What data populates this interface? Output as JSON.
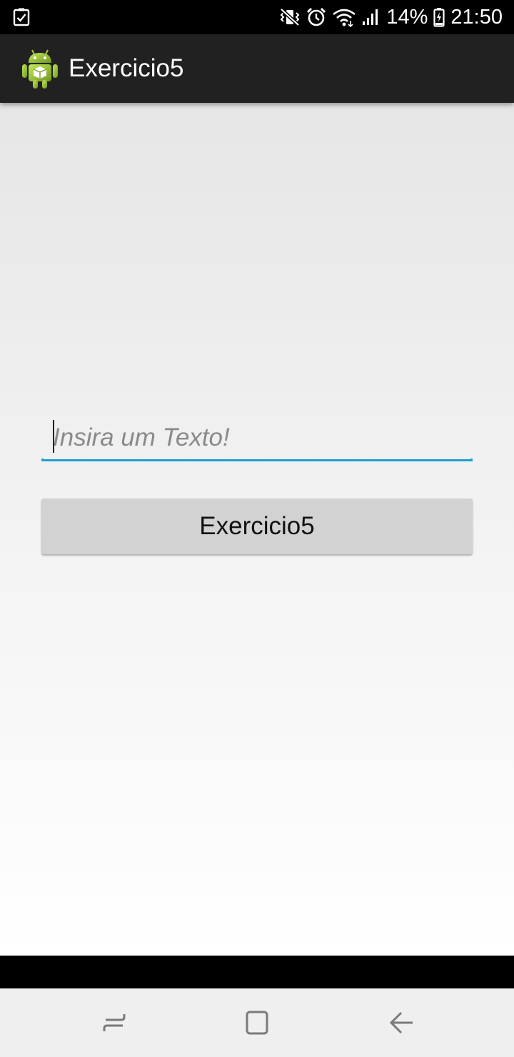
{
  "status_bar": {
    "battery_percent": "14%",
    "time": "21:50",
    "icons": [
      "task-check-icon",
      "vibrate-mute-icon",
      "alarm-icon",
      "wifi-icon",
      "signal-icon",
      "battery-charging-icon"
    ]
  },
  "action_bar": {
    "title": "Exercicio5",
    "icon": "android-robot-icon"
  },
  "main": {
    "text_field": {
      "value": "",
      "placeholder": "Insira um Texto!"
    },
    "button_label": "Exercicio5"
  },
  "nav_bar": {
    "icons": [
      "recent-apps-icon",
      "home-icon",
      "back-icon"
    ]
  },
  "colors": {
    "status_bar": "#000000",
    "action_bar": "#212121",
    "accent": "#1a9fd3",
    "button": "#d2d2d2",
    "nav_bar": "#efefef"
  }
}
